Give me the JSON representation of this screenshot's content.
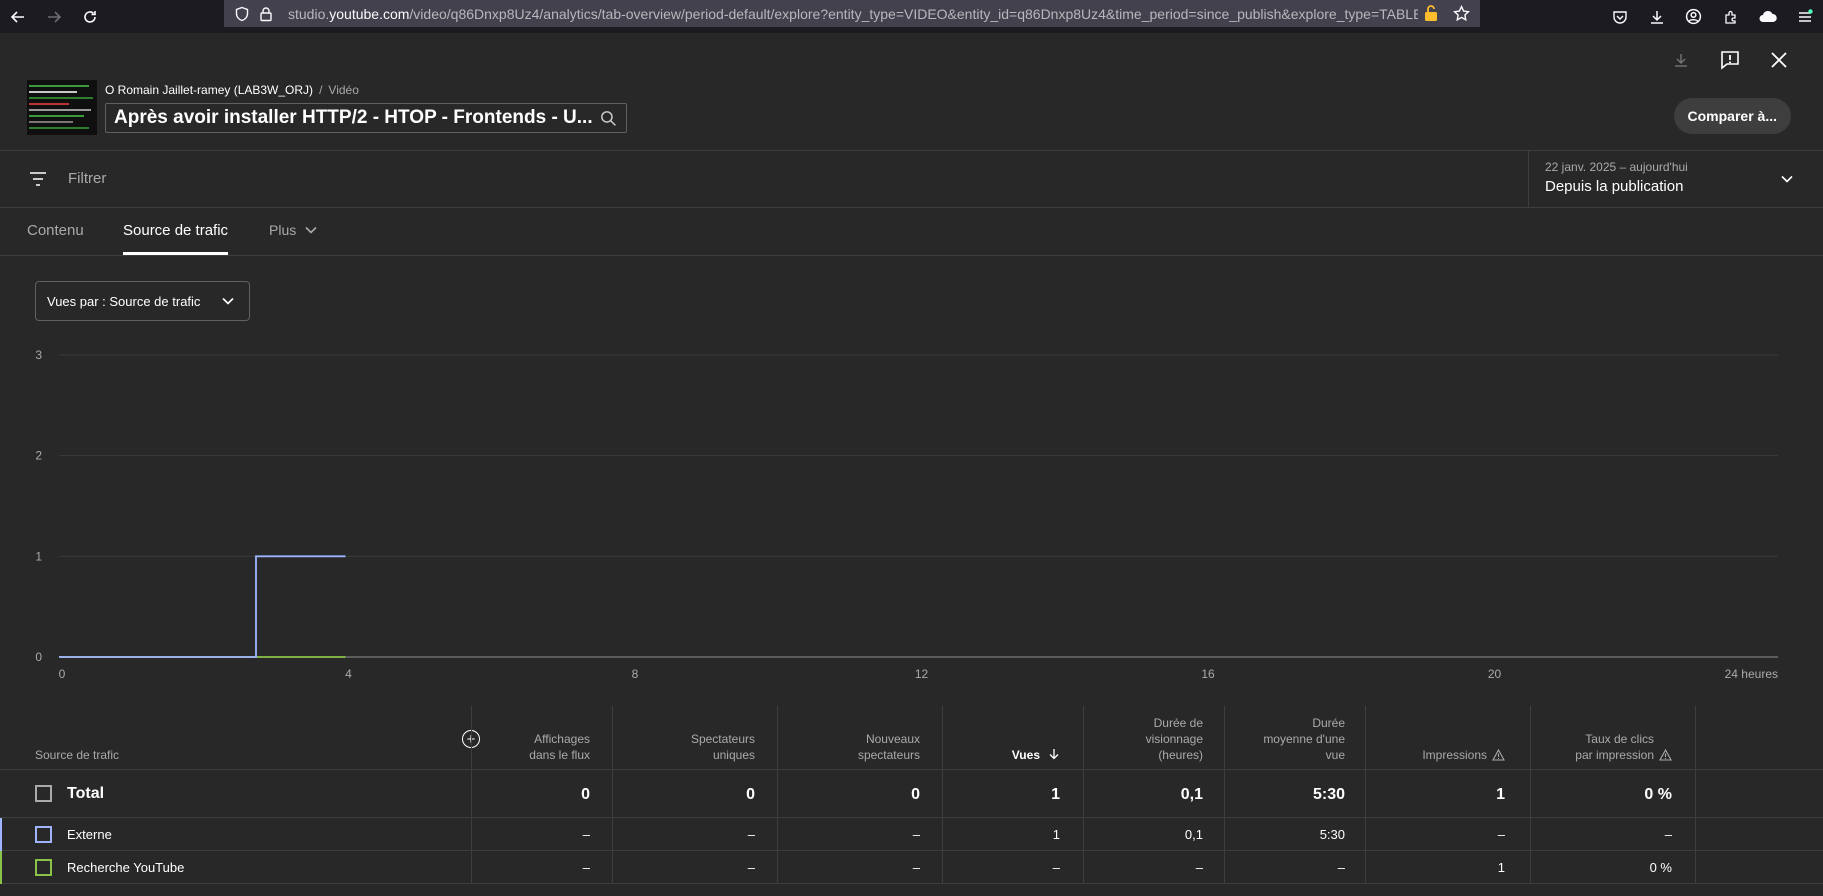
{
  "browser": {
    "url_prefix": "studio.",
    "url_host": "youtube.com",
    "url_path": "/video/q86Dnxp8Uz4/analytics/tab-overview/period-default/explore?entity_type=VIDEO&entity_id=q86Dnxp8Uz4&time_period=since_publish&explore_type=TABLE_"
  },
  "header": {
    "channel": "O Romain Jaillet-ramey (LAB3W_ORJ)",
    "separator": "/",
    "entity_type": "Vidéo",
    "video_title": "Après avoir installer HTTP/2 - HTOP - Frontends - U...",
    "compare_label": "Comparer à..."
  },
  "filter": {
    "placeholder": "Filtrer",
    "date_range": "22 janv. 2025 – aujourd'hui",
    "period_label": "Depuis la publication"
  },
  "tabs": [
    {
      "label": "Contenu",
      "active": false
    },
    {
      "label": "Source de trafic",
      "active": true
    },
    {
      "label": "Plus",
      "active": false
    }
  ],
  "metric_dropdown": {
    "label": "Vues par : Source de trafic"
  },
  "chart_data": {
    "type": "line",
    "xlabel": "",
    "ylabel": "",
    "x_ticks": [
      "0",
      "4",
      "8",
      "12",
      "16",
      "20",
      "24 heures"
    ],
    "xlim": [
      0,
      24
    ],
    "y_ticks": [
      "0",
      "1",
      "2",
      "3"
    ],
    "ylim": [
      0,
      3
    ],
    "grid": true,
    "series": [
      {
        "name": "Externe",
        "color": "#9fb4ff",
        "x": [
          0,
          2.75,
          2.75,
          4
        ],
        "y": [
          0,
          0,
          1,
          1
        ]
      },
      {
        "name": "Recherche YouTube",
        "color": "#8bc34a",
        "x": [
          0,
          4
        ],
        "y": [
          0,
          0
        ]
      }
    ]
  },
  "table": {
    "first_header": "Source de trafic",
    "headers": [
      [
        "Affichages",
        "dans le flux"
      ],
      [
        "Spectateurs",
        "uniques"
      ],
      [
        "Nouveaux",
        "spectateurs"
      ],
      [
        "Vues"
      ],
      [
        "Durée de",
        "visionnage",
        "(heures)"
      ],
      [
        "Durée",
        "moyenne d'une",
        "vue"
      ],
      [
        "Impressions"
      ],
      [
        "Taux de clics",
        "par impression"
      ]
    ],
    "header_flat": [
      "Affichages dans le flux",
      "Spectateurs uniques",
      "Nouveaux spectateurs",
      "Vues",
      "Durée de visionnage (heures)",
      "Durée moyenne d'une vue",
      "Impressions",
      "Taux de clics par impression"
    ],
    "total": {
      "label": "Total",
      "values": [
        "0",
        "0",
        "0",
        "1",
        "0,1",
        "5:30",
        "1",
        "0 %"
      ]
    },
    "rows": [
      {
        "label": "Externe",
        "color": "#9fb4ff",
        "values": [
          "–",
          "–",
          "–",
          "1",
          "0,1",
          "5:30",
          "–",
          "–"
        ]
      },
      {
        "label": "Recherche YouTube",
        "color": "#8bc34a",
        "values": [
          "–",
          "–",
          "–",
          "–",
          "–",
          "–",
          "1",
          "0 %"
        ]
      }
    ]
  }
}
